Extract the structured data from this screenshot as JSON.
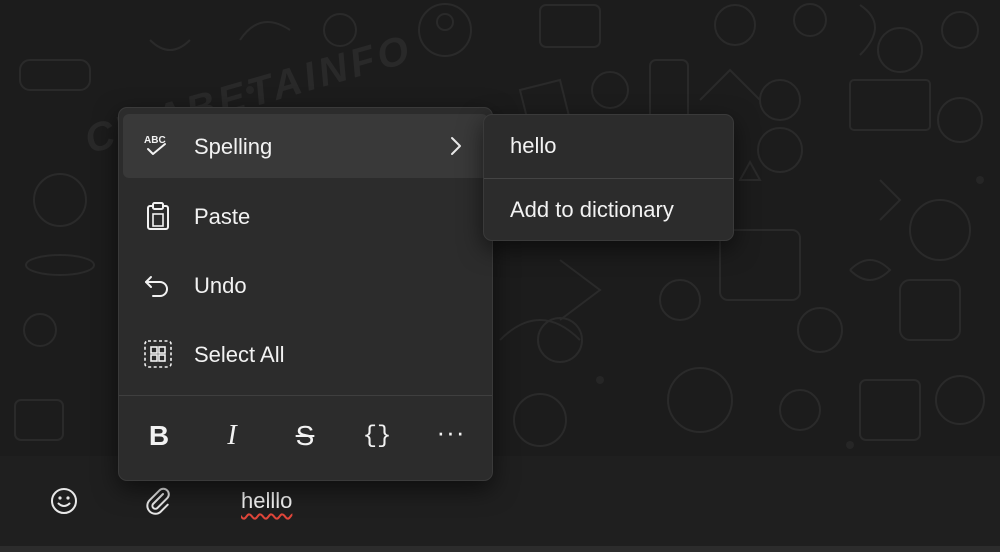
{
  "watermark": "CWABETAINFO",
  "context_menu": {
    "items": [
      {
        "label": "Spelling",
        "icon": "spellcheck-icon",
        "has_submenu": true,
        "highlighted": true
      },
      {
        "label": "Paste",
        "icon": "clipboard-icon"
      },
      {
        "label": "Undo",
        "icon": "undo-icon"
      },
      {
        "label": "Select All",
        "icon": "select-all-icon"
      }
    ],
    "spellcheck_icon_text": "ABC",
    "format_bar": {
      "bold": "B",
      "italic": "I",
      "strikethrough": "S",
      "monospace": "{}",
      "more": "···"
    }
  },
  "spelling_submenu": {
    "suggestion": "hello",
    "add_to_dictionary": "Add to dictionary"
  },
  "composer": {
    "text": "helllo",
    "emoji_icon": "smiley-icon",
    "attach_icon": "paperclip-icon"
  },
  "colors": {
    "menu_bg": "#2c2c2c",
    "highlight_bg": "#393939",
    "text": "#f2f2f2",
    "spell_error_underline": "#e0463a",
    "chat_bg": "#1c1c1c",
    "composer_bg": "#1f1f1f"
  }
}
